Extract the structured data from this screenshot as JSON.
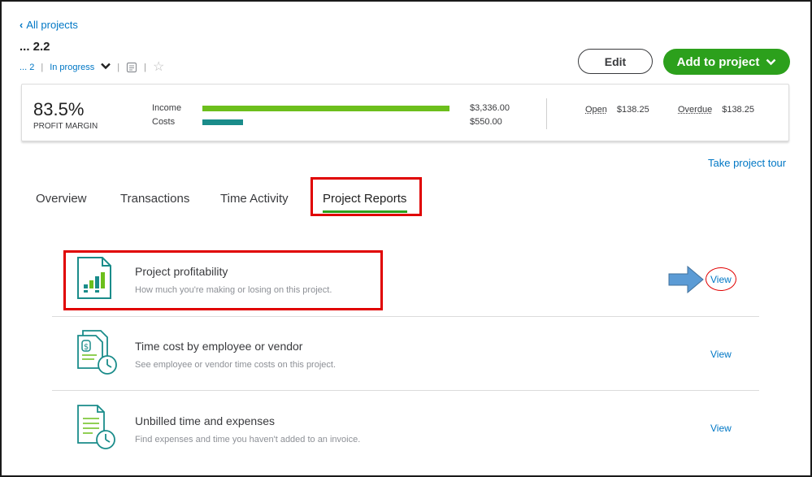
{
  "nav": {
    "back_label": "All projects"
  },
  "project": {
    "title": "... 2.2",
    "customer": "... 2",
    "status": "In progress"
  },
  "actions": {
    "edit_label": "Edit",
    "add_label": "Add to project"
  },
  "summary": {
    "profit_margin_value": "83.5%",
    "profit_margin_label": "PROFIT MARGIN",
    "income_label": "Income",
    "income_amount": "$3,336.00",
    "costs_label": "Costs",
    "costs_amount": "$550.00",
    "income_fraction": 1.0,
    "costs_fraction": 0.165,
    "open_label": "Open",
    "open_amount": "$138.25",
    "overdue_label": "Overdue",
    "overdue_amount": "$138.25",
    "colors": {
      "income_bar": "#6cbf1c",
      "costs_bar": "#1a8c8a"
    }
  },
  "tour_label": "Take project tour",
  "tabs": [
    {
      "label": "Overview"
    },
    {
      "label": "Transactions"
    },
    {
      "label": "Time Activity"
    },
    {
      "label": "Project Reports",
      "active": true
    }
  ],
  "reports": [
    {
      "title": "Project profitability",
      "description": "How much you're making or losing on this project.",
      "view_label": "View",
      "icon": "profitability-report-icon"
    },
    {
      "title": "Time cost by employee or vendor",
      "description": "See employee or vendor time costs on this project.",
      "view_label": "View",
      "icon": "time-cost-report-icon"
    },
    {
      "title": "Unbilled time and expenses",
      "description": "Find expenses and time you haven't added to an invoice.",
      "view_label": "View",
      "icon": "unbilled-report-icon"
    }
  ],
  "colors": {
    "accent_green": "#2ca01c",
    "link_blue": "#0077c5",
    "annotation_red": "#e00000",
    "annotation_arrow": "#5b9bd5"
  }
}
